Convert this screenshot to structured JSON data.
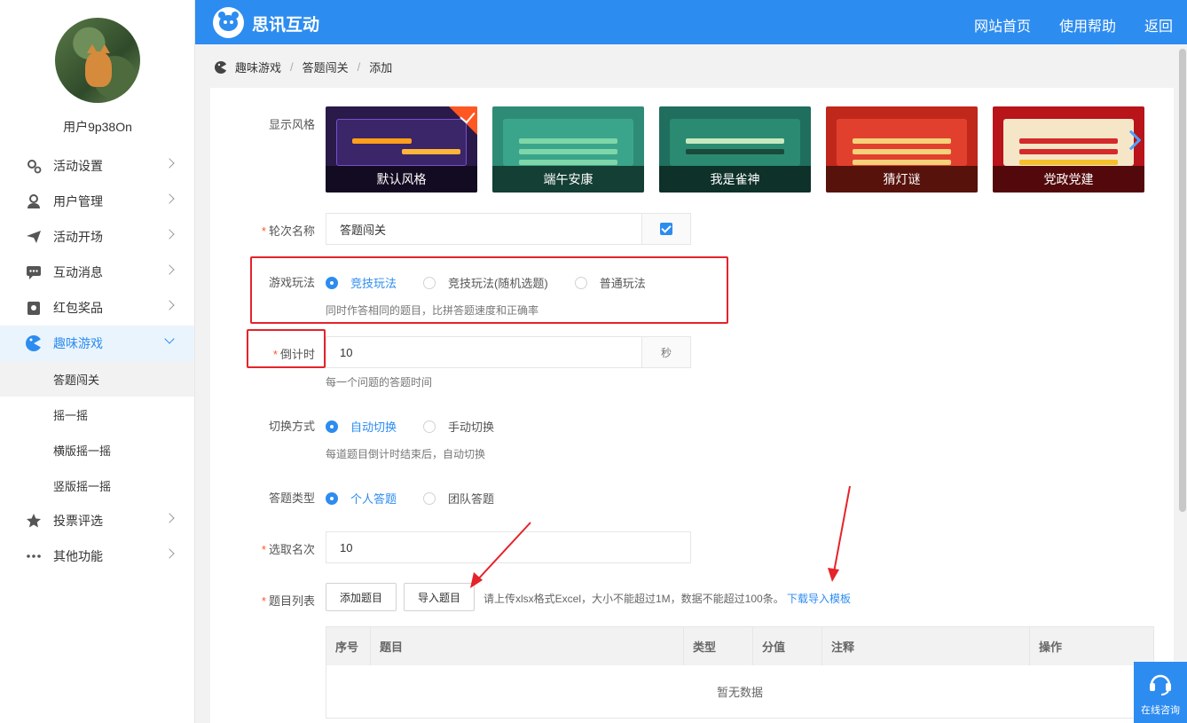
{
  "header": {
    "brand": "思讯互动",
    "nav": [
      "网站首页",
      "使用帮助",
      "返回"
    ]
  },
  "sidebar": {
    "username": "用户9p38On",
    "menu": [
      {
        "label": "活动设置",
        "icon": "gear-icon"
      },
      {
        "label": "用户管理",
        "icon": "user-icon"
      },
      {
        "label": "活动开场",
        "icon": "paper-plane-icon"
      },
      {
        "label": "互动消息",
        "icon": "chat-icon"
      },
      {
        "label": "红包奖品",
        "icon": "gift-icon"
      },
      {
        "label": "趣味游戏",
        "icon": "game-icon"
      }
    ],
    "submenu": [
      "答题闯关",
      "摇一摇",
      "横版摇一摇",
      "竖版摇一摇"
    ],
    "menu_after": [
      {
        "label": "投票评选",
        "icon": "star-icon"
      },
      {
        "label": "其他功能",
        "icon": "more-icon"
      }
    ]
  },
  "breadcrumb": [
    "趣味游戏",
    "答题闯关",
    "添加"
  ],
  "form": {
    "style_label": "显示风格",
    "themes": [
      {
        "name": "默认风格",
        "bg": "#2a1a4a",
        "accent": "#ff9f1a"
      },
      {
        "name": "端午安康",
        "bg": "#2e8c76",
        "accent": "#7fd6a8"
      },
      {
        "name": "我是雀神",
        "bg": "#1f6e5e",
        "accent": "#c8e8c0"
      },
      {
        "name": "猜灯谜",
        "bg": "#c0281c",
        "accent": "#f5d27a"
      },
      {
        "name": "党政党建",
        "bg": "#b8141a",
        "accent": "#f5e6c8"
      }
    ],
    "round_label": "轮次名称",
    "round_value": "答题闯关",
    "play_label": "游戏玩法",
    "play_options": [
      "竞技玩法",
      "竞技玩法(随机选题)",
      "普通玩法"
    ],
    "play_hint": "同时作答相同的题目，比拼答题速度和正确率",
    "countdown_label": "倒计时",
    "countdown_value": "10",
    "countdown_unit": "秒",
    "countdown_hint": "每一个问题的答题时间",
    "switch_label": "切换方式",
    "switch_options": [
      "自动切换",
      "手动切换"
    ],
    "switch_hint": "每道题目倒计时结束后，自动切换",
    "answer_type_label": "答题类型",
    "answer_type_options": [
      "个人答题",
      "团队答题"
    ],
    "pick_label": "选取名次",
    "pick_value": "10",
    "questions_label": "题目列表",
    "add_btn": "添加题目",
    "import_btn": "导入题目",
    "import_hint": "请上传xlsx格式Excel，大小不能超过1M，数据不能超过100条。",
    "template_link": "下载导入模板",
    "table_headers": [
      "序号",
      "题目",
      "类型",
      "分值",
      "注释",
      "操作"
    ],
    "table_empty": "暂无数据"
  },
  "chat_widget": "在线咨询",
  "colors": {
    "primary": "#2d8cf0",
    "highlight": "#e5232a",
    "required": "#ff5722"
  }
}
